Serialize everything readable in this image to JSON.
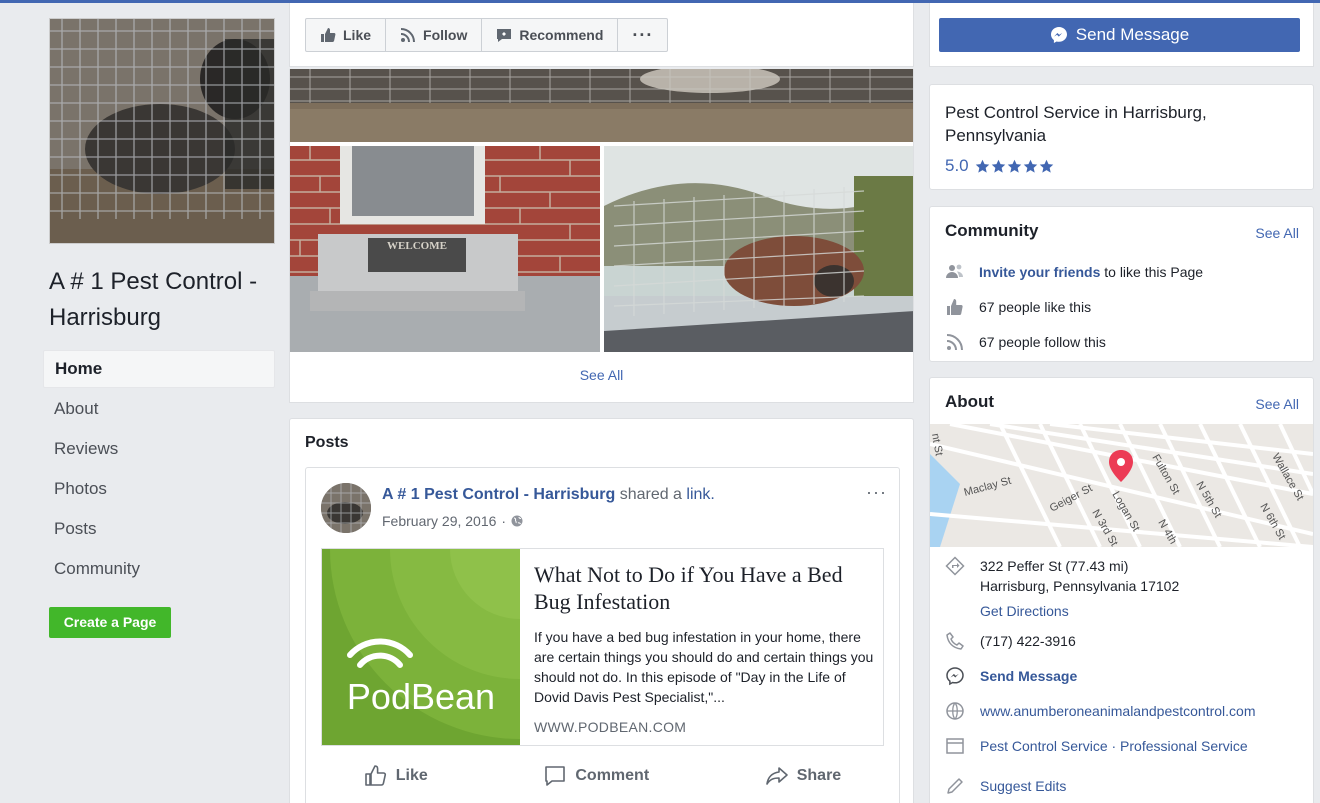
{
  "page": {
    "name": "A # 1 Pest Control - Harrisburg"
  },
  "nav": {
    "items": [
      {
        "label": "Home",
        "active": true
      },
      {
        "label": "About"
      },
      {
        "label": "Reviews"
      },
      {
        "label": "Photos"
      },
      {
        "label": "Posts"
      },
      {
        "label": "Community"
      }
    ],
    "create_page": "Create a Page"
  },
  "action_bar": {
    "like": "Like",
    "follow": "Follow",
    "recommend": "Recommend",
    "more": "···",
    "send_message": "Send Message"
  },
  "photos": {
    "see_all": "See All",
    "welcome_mat": "WELCOME"
  },
  "posts": {
    "title": "Posts",
    "post": {
      "author": "A # 1 Pest Control - Harrisburg",
      "action": "shared a",
      "link_word": "link.",
      "date": "February 29, 2016",
      "more": "···",
      "link": {
        "logo_text": "PodBean",
        "title": "What Not to Do if You Have a Bed Bug Infestation",
        "description": "If you have a bed bug infestation in your home, there are certain things you should do and certain things you should not do. In this episode of \"Day in the Life of Dovid Davis Pest Specialist,\"...",
        "domain": "WWW.PODBEAN.COM"
      },
      "actions": {
        "like": "Like",
        "comment": "Comment",
        "share": "Share"
      }
    }
  },
  "info": {
    "category_line": "Pest Control Service in Harrisburg, Pennsylvania",
    "rating": "5.0",
    "stars": 5
  },
  "community": {
    "title": "Community",
    "see_all": "See All",
    "invite_link": "Invite your friends",
    "invite_rest": "to like this Page",
    "likes": "67 people like this",
    "follows": "67 people follow this"
  },
  "about": {
    "title": "About",
    "see_all": "See All",
    "map_streets": [
      "Maclay St",
      "Geiger St",
      "Logan St",
      "N 3rd St",
      "Fulton St",
      "N 4th",
      "N 5th St",
      "N 6th St",
      "Wallace St",
      "nt St"
    ],
    "address_line1": "322 Peffer St (77.43 mi)",
    "address_line2": "Harrisburg, Pennsylvania 17102",
    "directions": "Get Directions",
    "phone": "(717) 422-3916",
    "send_message": "Send Message",
    "website": "www.anumberoneanimalandpestcontrol.com",
    "categories": "Pest Control Service · Professional Service",
    "suggest": "Suggest Edits"
  },
  "colors": {
    "brand": "#4267b2",
    "link": "#365899",
    "create_button": "#42b72a",
    "map_pin": "#ec3b55",
    "podbean_green": "#6ea531"
  }
}
